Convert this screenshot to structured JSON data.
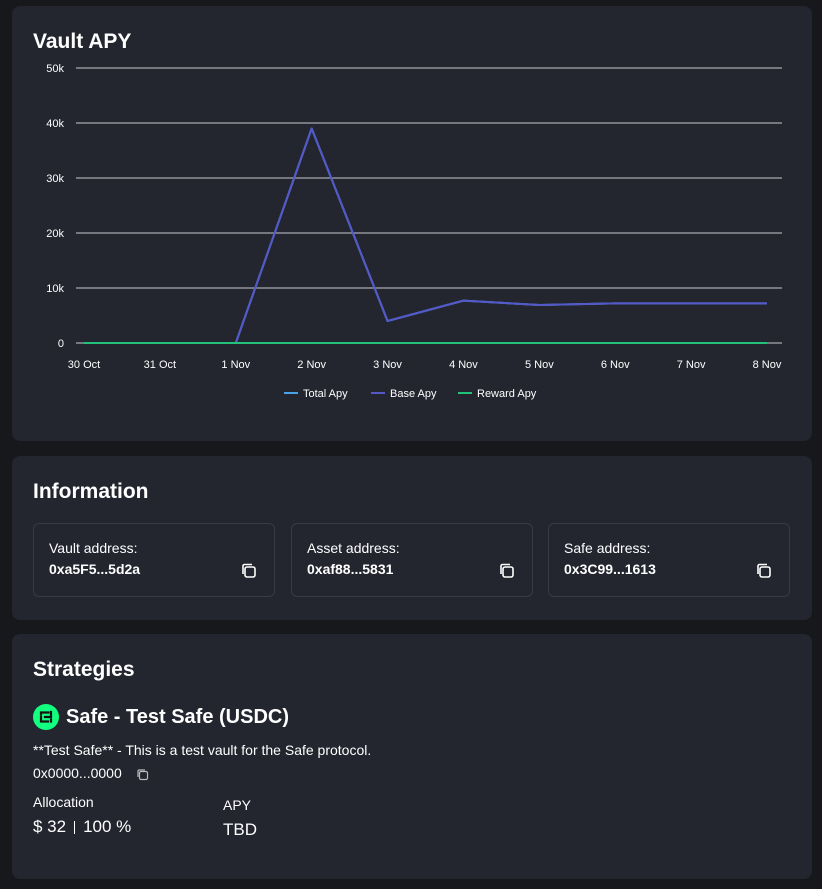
{
  "vault_apy": {
    "title": "Vault APY"
  },
  "chart_data": {
    "type": "line",
    "title": "Vault APY",
    "xlabel": "",
    "ylabel": "",
    "x": [
      "30 Oct",
      "31 Oct",
      "1 Nov",
      "2 Nov",
      "3 Nov",
      "4 Nov",
      "5 Nov",
      "6 Nov",
      "7 Nov",
      "8 Nov"
    ],
    "y_ticks": [
      "0",
      "10k",
      "20k",
      "30k",
      "40k",
      "50k"
    ],
    "ylim": [
      0,
      50000
    ],
    "grid": true,
    "legend_position": "bottom",
    "series": [
      {
        "name": "Total Apy",
        "color": "#4aa3e8",
        "values": [
          0,
          0,
          0,
          39000,
          4000,
          7700,
          6900,
          7200,
          7200,
          7200
        ]
      },
      {
        "name": "Base Apy",
        "color": "#5558c9",
        "values": [
          0,
          0,
          0,
          39000,
          4000,
          7700,
          6900,
          7200,
          7200,
          7200
        ]
      },
      {
        "name": "Reward Apy",
        "color": "#22c27a",
        "values": [
          0,
          0,
          0,
          0,
          0,
          0,
          0,
          0,
          0,
          0
        ]
      }
    ]
  },
  "information": {
    "title": "Information",
    "items": [
      {
        "label": "Vault address:",
        "value": "0xa5F5...5d2a"
      },
      {
        "label": "Asset address:",
        "value": "0xaf88...5831"
      },
      {
        "label": "Safe address:",
        "value": "0x3C99...1613"
      }
    ]
  },
  "strategies": {
    "title": "Strategies",
    "name": "Safe - Test Safe (USDC)",
    "description": "**Test Safe** - This is a test vault for the Safe protocol.",
    "address": "0x0000...0000",
    "allocation_label": "Allocation",
    "allocation_amount": "$ 32",
    "allocation_percent": "100 %",
    "apy_label": "APY",
    "apy_value": "TBD",
    "logo_color": "#12ff80"
  }
}
